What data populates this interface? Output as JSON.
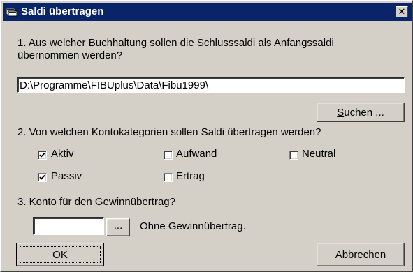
{
  "window": {
    "title": "Saldi übertragen",
    "close_glyph": "✕",
    "icon": "dialog-app-icon"
  },
  "step1": {
    "question": "1. Aus welcher Buchhaltung sollen die Schlusssaldi als Anfangssaldi übernommen werden?",
    "path_value": "D:\\Programme\\FIBUplus\\Data\\Fibu1999\\",
    "search_button": {
      "mnemonic": "S",
      "rest": "uchen ..."
    }
  },
  "step2": {
    "question": "2. Von welchen Kontokategorien sollen Saldi übertragen werden?",
    "categories": [
      {
        "label": "Aktiv",
        "checked": true
      },
      {
        "label": "Aufwand",
        "checked": false
      },
      {
        "label": "Neutral",
        "checked": false
      },
      {
        "label": "Passiv",
        "checked": true
      },
      {
        "label": "Ertrag",
        "checked": false
      }
    ]
  },
  "step3": {
    "question": "3. Konto für den Gewinnübertrag?",
    "account_value": "",
    "browse_label": "...",
    "account_description": "Ohne Gewinnübertrag."
  },
  "footer": {
    "ok_button": {
      "mnemonic": "O",
      "rest": "K"
    },
    "cancel_button": {
      "mnemonic": "A",
      "rest": "bbrechen"
    }
  }
}
